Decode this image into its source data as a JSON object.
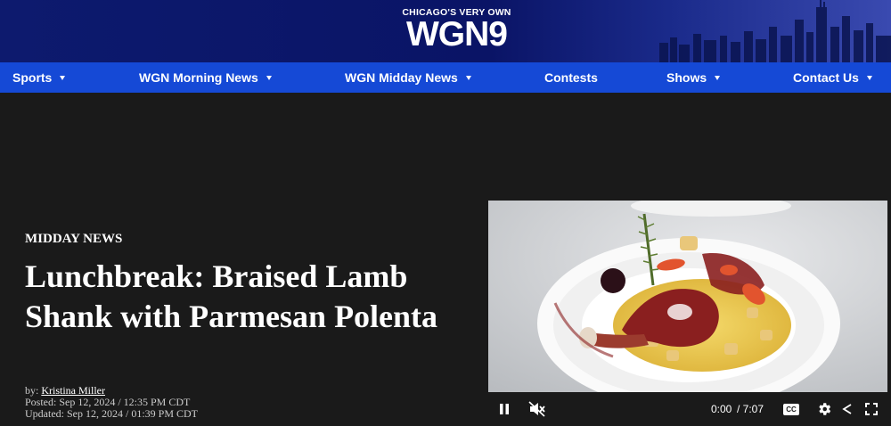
{
  "header": {
    "logo_tagline": "CHICAGO'S VERY OWN",
    "logo_text": "WGN9"
  },
  "nav": {
    "items": [
      {
        "label": "Sports",
        "has_dropdown": true
      },
      {
        "label": "WGN Morning News",
        "has_dropdown": true
      },
      {
        "label": "WGN Midday News",
        "has_dropdown": true
      },
      {
        "label": "Contests",
        "has_dropdown": false
      },
      {
        "label": "Shows",
        "has_dropdown": true
      },
      {
        "label": "Contact Us",
        "has_dropdown": true
      }
    ]
  },
  "article": {
    "kicker": "MIDDAY NEWS",
    "title": "Lunchbreak: Braised Lamb Shank with Parmesan Polenta",
    "byline_prefix": "by:",
    "author": "Kristina Miller",
    "posted": "Posted: Sep 12, 2024 / 12:35 PM CDT",
    "updated": "Updated: Sep 12, 2024 / 01:39 PM CDT"
  },
  "video": {
    "current_time": "0:00",
    "duration": "/ 7:07",
    "cc_label": "CC",
    "state": "playing",
    "muted": true
  },
  "colors": {
    "header_bg": "#0d1a6e",
    "nav_bg": "#1549d6",
    "page_bg": "#1a1a1a"
  },
  "icons": [
    "pause-icon",
    "mute-icon",
    "cc-icon",
    "gear-icon",
    "share-icon",
    "fullscreen-icon",
    "caret-down-icon"
  ]
}
